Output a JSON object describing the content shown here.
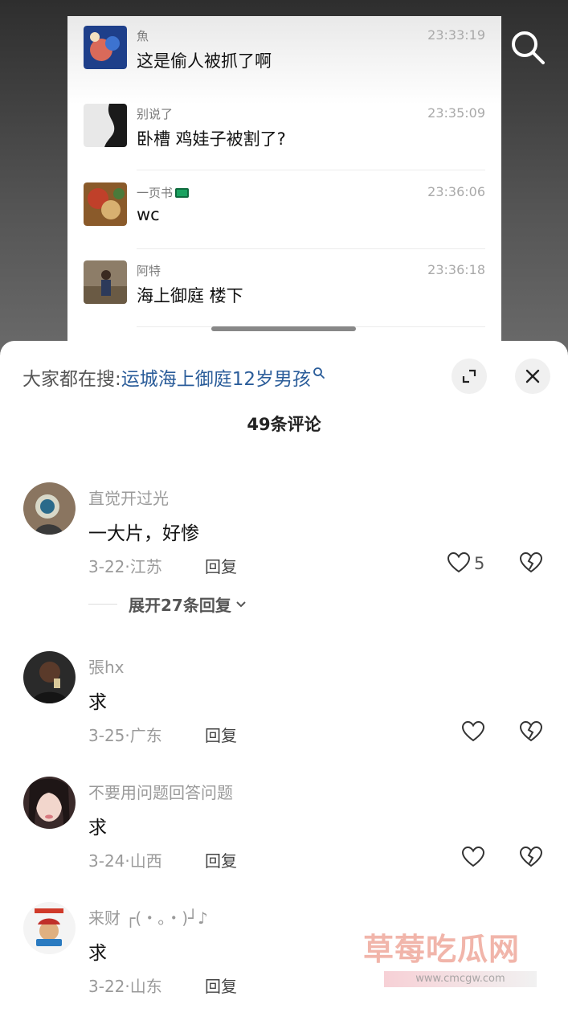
{
  "chat": {
    "messages": [
      {
        "name": "魚",
        "time": "23:33:19",
        "text": "这是偷人被抓了啊"
      },
      {
        "name": "别说了",
        "time": "23:35:09",
        "text": "卧槽 鸡娃子被割了?"
      },
      {
        "name": "一页书",
        "time": "23:36:06",
        "text": "wc"
      },
      {
        "name": "阿特",
        "time": "23:36:18",
        "text": "海上御庭 楼下"
      }
    ]
  },
  "sheet": {
    "suggest_prefix": "大家都在搜:",
    "suggest_query": "运城海上御庭12岁男孩",
    "comment_count": "49条评论"
  },
  "comments": [
    {
      "name": "直觉开过光",
      "text": "一大片，好惨",
      "meta": "3-22·江苏",
      "reply": "回复",
      "likes": "5",
      "expand": "展开27条回复"
    },
    {
      "name": "張hx",
      "text": "求",
      "meta": "3-25·广东",
      "reply": "回复"
    },
    {
      "name": "不要用问题回答问题",
      "text": "求",
      "meta": "3-24·山西",
      "reply": "回复"
    },
    {
      "name": "来财 ┌(・。・)┘♪",
      "text": "求",
      "meta": "3-22·山东",
      "reply": "回复"
    }
  ],
  "watermark": {
    "title": "草莓吃瓜网",
    "url": "www.cmcgw.com"
  },
  "icons": {
    "search": "search-icon",
    "expand": "expand-icon",
    "close": "close-icon",
    "like": "heart-icon",
    "dislike": "broken-heart-icon",
    "chevron": "chevron-down-icon"
  }
}
